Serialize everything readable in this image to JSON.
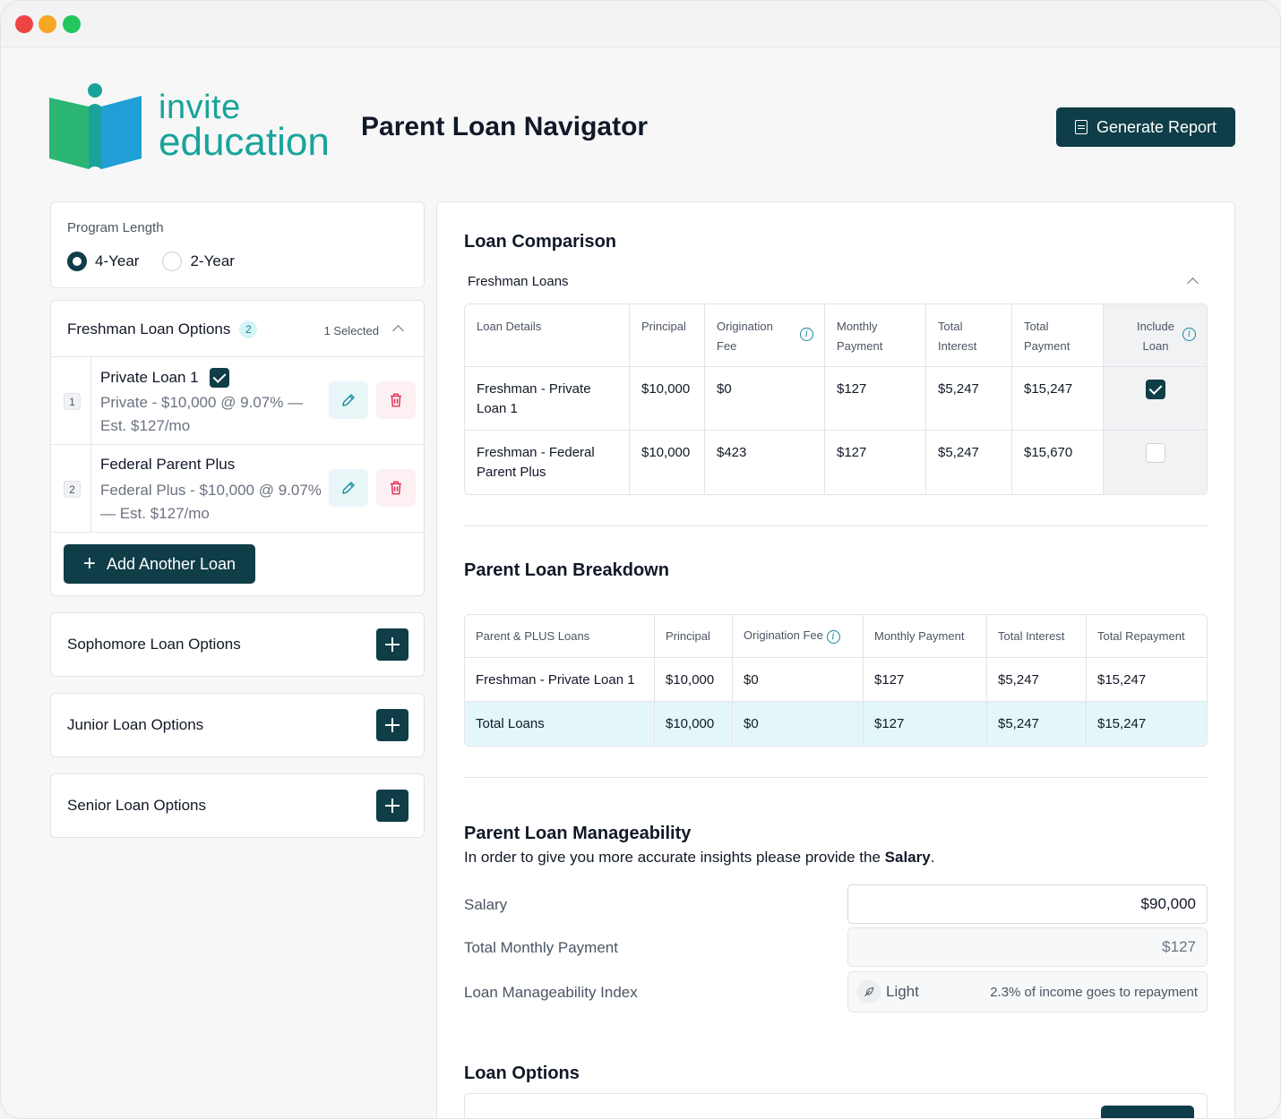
{
  "brand": {
    "logo_line1": "invite",
    "logo_line2": "education"
  },
  "header": {
    "title": "Parent Loan Navigator",
    "generate_label": "Generate Report"
  },
  "program": {
    "label": "Program Length",
    "options": [
      {
        "label": "4-Year",
        "selected": true
      },
      {
        "label": "2-Year",
        "selected": false
      }
    ]
  },
  "freshman": {
    "title": "Freshman Loan Options",
    "count": "2",
    "selected_text": "1 Selected",
    "loans": [
      {
        "index": "1",
        "name": "Private Loan 1",
        "checked": true,
        "desc": "Private - $10,000 @ 9.07% — Est. $127/mo"
      },
      {
        "index": "2",
        "name": "Federal Parent Plus",
        "checked": false,
        "desc": "Federal Plus - $10,000 @ 9.07% — Est. $127/mo"
      }
    ],
    "add_label": "Add Another Loan"
  },
  "years": [
    {
      "label": "Sophomore Loan Options"
    },
    {
      "label": "Junior Loan Options"
    },
    {
      "label": "Senior Loan Options"
    }
  ],
  "comparison": {
    "title": "Loan Comparison",
    "group": "Freshman Loans",
    "headers": [
      "Loan Details",
      "Principal",
      "Origination Fee",
      "Monthly Payment",
      "Total Interest",
      "Total Payment",
      "Include Loan"
    ],
    "rows": [
      {
        "details": "Freshman - Private Loan 1",
        "principal": "$10,000",
        "fee": "$0",
        "monthly": "$127",
        "interest": "$5,247",
        "total": "$15,247",
        "include": true
      },
      {
        "details": "Freshman - Federal Parent Plus",
        "principal": "$10,000",
        "fee": "$423",
        "monthly": "$127",
        "interest": "$5,247",
        "total": "$15,670",
        "include": false
      }
    ]
  },
  "breakdown": {
    "title": "Parent Loan Breakdown",
    "headers": [
      "Parent & PLUS Loans",
      "Principal",
      "Origination Fee",
      "Monthly Payment",
      "Total Interest",
      "Total Repayment"
    ],
    "rows": [
      [
        "Freshman - Private Loan 1",
        "$10,000",
        "$0",
        "$127",
        "$5,247",
        "$15,247"
      ]
    ],
    "total": [
      "Total Loans",
      "$10,000",
      "$0",
      "$127",
      "$5,247",
      "$15,247"
    ]
  },
  "manageability": {
    "title": "Parent Loan Manageability",
    "desc_prefix": "In order to give you more accurate insights please provide the ",
    "desc_bold": "Salary",
    "desc_suffix": ".",
    "salary_label": "Salary",
    "salary_value": "$90,000",
    "monthly_label": "Total Monthly Payment",
    "monthly_value": "$127",
    "index_label": "Loan Manageability Index",
    "index_value": "Light",
    "index_note": "2.3% of income goes to repayment"
  },
  "options": {
    "title": "Loan Options"
  },
  "colors": {
    "primary": "#0f3d48",
    "accent": "#0e8a9b",
    "brand": "#1aa39a",
    "delete": "#e11d48"
  }
}
